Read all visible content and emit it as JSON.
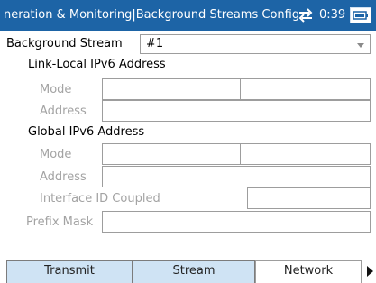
{
  "header": {
    "title": "neration & Monitoring|Background Streams Config",
    "time": "0:39",
    "sync_icon": "sync-arrows-icon",
    "battery_icon": "battery-icon"
  },
  "stream": {
    "label": "Background Stream",
    "value": "#1"
  },
  "link_local": {
    "heading": "Link-Local IPv6 Address",
    "mode_label": "Mode",
    "address_label": "Address"
  },
  "global": {
    "heading": "Global IPv6 Address",
    "mode_label": "Mode",
    "address_label": "Address",
    "interface_label": "Interface ID Coupled"
  },
  "prefix": {
    "label": "Prefix Mask"
  },
  "tabs": [
    {
      "label": "Transmit",
      "active": false
    },
    {
      "label": "Stream",
      "active": false
    },
    {
      "label": "Network",
      "active": true
    }
  ]
}
